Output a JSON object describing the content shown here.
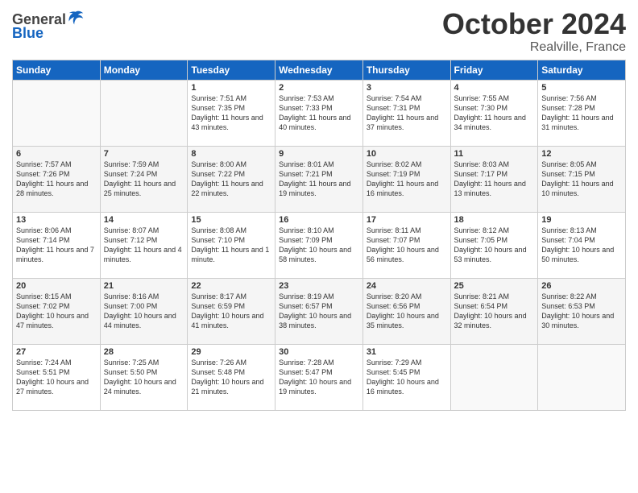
{
  "header": {
    "logo_general": "General",
    "logo_blue": "Blue",
    "month": "October 2024",
    "location": "Realville, France"
  },
  "days_of_week": [
    "Sunday",
    "Monday",
    "Tuesday",
    "Wednesday",
    "Thursday",
    "Friday",
    "Saturday"
  ],
  "weeks": [
    [
      {
        "day": "",
        "sunrise": "",
        "sunset": "",
        "daylight": ""
      },
      {
        "day": "",
        "sunrise": "",
        "sunset": "",
        "daylight": ""
      },
      {
        "day": "1",
        "sunrise": "Sunrise: 7:51 AM",
        "sunset": "Sunset: 7:35 PM",
        "daylight": "Daylight: 11 hours and 43 minutes."
      },
      {
        "day": "2",
        "sunrise": "Sunrise: 7:53 AM",
        "sunset": "Sunset: 7:33 PM",
        "daylight": "Daylight: 11 hours and 40 minutes."
      },
      {
        "day": "3",
        "sunrise": "Sunrise: 7:54 AM",
        "sunset": "Sunset: 7:31 PM",
        "daylight": "Daylight: 11 hours and 37 minutes."
      },
      {
        "day": "4",
        "sunrise": "Sunrise: 7:55 AM",
        "sunset": "Sunset: 7:30 PM",
        "daylight": "Daylight: 11 hours and 34 minutes."
      },
      {
        "day": "5",
        "sunrise": "Sunrise: 7:56 AM",
        "sunset": "Sunset: 7:28 PM",
        "daylight": "Daylight: 11 hours and 31 minutes."
      }
    ],
    [
      {
        "day": "6",
        "sunrise": "Sunrise: 7:57 AM",
        "sunset": "Sunset: 7:26 PM",
        "daylight": "Daylight: 11 hours and 28 minutes."
      },
      {
        "day": "7",
        "sunrise": "Sunrise: 7:59 AM",
        "sunset": "Sunset: 7:24 PM",
        "daylight": "Daylight: 11 hours and 25 minutes."
      },
      {
        "day": "8",
        "sunrise": "Sunrise: 8:00 AM",
        "sunset": "Sunset: 7:22 PM",
        "daylight": "Daylight: 11 hours and 22 minutes."
      },
      {
        "day": "9",
        "sunrise": "Sunrise: 8:01 AM",
        "sunset": "Sunset: 7:21 PM",
        "daylight": "Daylight: 11 hours and 19 minutes."
      },
      {
        "day": "10",
        "sunrise": "Sunrise: 8:02 AM",
        "sunset": "Sunset: 7:19 PM",
        "daylight": "Daylight: 11 hours and 16 minutes."
      },
      {
        "day": "11",
        "sunrise": "Sunrise: 8:03 AM",
        "sunset": "Sunset: 7:17 PM",
        "daylight": "Daylight: 11 hours and 13 minutes."
      },
      {
        "day": "12",
        "sunrise": "Sunrise: 8:05 AM",
        "sunset": "Sunset: 7:15 PM",
        "daylight": "Daylight: 11 hours and 10 minutes."
      }
    ],
    [
      {
        "day": "13",
        "sunrise": "Sunrise: 8:06 AM",
        "sunset": "Sunset: 7:14 PM",
        "daylight": "Daylight: 11 hours and 7 minutes."
      },
      {
        "day": "14",
        "sunrise": "Sunrise: 8:07 AM",
        "sunset": "Sunset: 7:12 PM",
        "daylight": "Daylight: 11 hours and 4 minutes."
      },
      {
        "day": "15",
        "sunrise": "Sunrise: 8:08 AM",
        "sunset": "Sunset: 7:10 PM",
        "daylight": "Daylight: 11 hours and 1 minute."
      },
      {
        "day": "16",
        "sunrise": "Sunrise: 8:10 AM",
        "sunset": "Sunset: 7:09 PM",
        "daylight": "Daylight: 10 hours and 58 minutes."
      },
      {
        "day": "17",
        "sunrise": "Sunrise: 8:11 AM",
        "sunset": "Sunset: 7:07 PM",
        "daylight": "Daylight: 10 hours and 56 minutes."
      },
      {
        "day": "18",
        "sunrise": "Sunrise: 8:12 AM",
        "sunset": "Sunset: 7:05 PM",
        "daylight": "Daylight: 10 hours and 53 minutes."
      },
      {
        "day": "19",
        "sunrise": "Sunrise: 8:13 AM",
        "sunset": "Sunset: 7:04 PM",
        "daylight": "Daylight: 10 hours and 50 minutes."
      }
    ],
    [
      {
        "day": "20",
        "sunrise": "Sunrise: 8:15 AM",
        "sunset": "Sunset: 7:02 PM",
        "daylight": "Daylight: 10 hours and 47 minutes."
      },
      {
        "day": "21",
        "sunrise": "Sunrise: 8:16 AM",
        "sunset": "Sunset: 7:00 PM",
        "daylight": "Daylight: 10 hours and 44 minutes."
      },
      {
        "day": "22",
        "sunrise": "Sunrise: 8:17 AM",
        "sunset": "Sunset: 6:59 PM",
        "daylight": "Daylight: 10 hours and 41 minutes."
      },
      {
        "day": "23",
        "sunrise": "Sunrise: 8:19 AM",
        "sunset": "Sunset: 6:57 PM",
        "daylight": "Daylight: 10 hours and 38 minutes."
      },
      {
        "day": "24",
        "sunrise": "Sunrise: 8:20 AM",
        "sunset": "Sunset: 6:56 PM",
        "daylight": "Daylight: 10 hours and 35 minutes."
      },
      {
        "day": "25",
        "sunrise": "Sunrise: 8:21 AM",
        "sunset": "Sunset: 6:54 PM",
        "daylight": "Daylight: 10 hours and 32 minutes."
      },
      {
        "day": "26",
        "sunrise": "Sunrise: 8:22 AM",
        "sunset": "Sunset: 6:53 PM",
        "daylight": "Daylight: 10 hours and 30 minutes."
      }
    ],
    [
      {
        "day": "27",
        "sunrise": "Sunrise: 7:24 AM",
        "sunset": "Sunset: 5:51 PM",
        "daylight": "Daylight: 10 hours and 27 minutes."
      },
      {
        "day": "28",
        "sunrise": "Sunrise: 7:25 AM",
        "sunset": "Sunset: 5:50 PM",
        "daylight": "Daylight: 10 hours and 24 minutes."
      },
      {
        "day": "29",
        "sunrise": "Sunrise: 7:26 AM",
        "sunset": "Sunset: 5:48 PM",
        "daylight": "Daylight: 10 hours and 21 minutes."
      },
      {
        "day": "30",
        "sunrise": "Sunrise: 7:28 AM",
        "sunset": "Sunset: 5:47 PM",
        "daylight": "Daylight: 10 hours and 19 minutes."
      },
      {
        "day": "31",
        "sunrise": "Sunrise: 7:29 AM",
        "sunset": "Sunset: 5:45 PM",
        "daylight": "Daylight: 10 hours and 16 minutes."
      },
      {
        "day": "",
        "sunrise": "",
        "sunset": "",
        "daylight": ""
      },
      {
        "day": "",
        "sunrise": "",
        "sunset": "",
        "daylight": ""
      }
    ]
  ]
}
